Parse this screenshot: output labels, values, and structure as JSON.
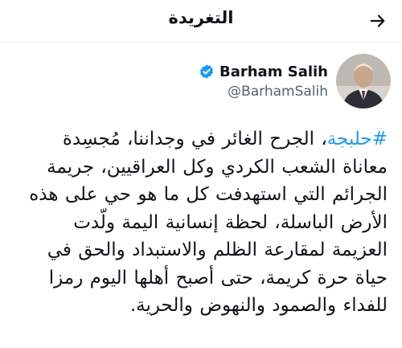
{
  "header": {
    "title": "التغريدة",
    "back_icon": "arrow-right-icon"
  },
  "author": {
    "display_name": "Barham Salih",
    "handle": "@BarhamSalih",
    "verified_icon": "verified-badge-icon",
    "verified_color": "#1d9bf0"
  },
  "tweet": {
    "hashtag": "#حلبجة",
    "text": "، الجرح الغائر في وجداننا، مُجسِدة معاناة الشعب الكردي وكل العراقيين، جريمة الجرائم التي استهدفت كل ما هو حي على هذه الأرض الباسلة، لحظة إنسانية اليمة ولّدت العزيمة لمقارعة الظلم والاستبداد والحق في حياة حرة كريمة، حتى أصبح أهلها اليوم رمزا للفداء والصمود والنهوض والحرية."
  },
  "colors": {
    "link": "#1d9bf0",
    "text": "#0f1419",
    "secondary": "#536471",
    "divider": "#eff3f4"
  }
}
